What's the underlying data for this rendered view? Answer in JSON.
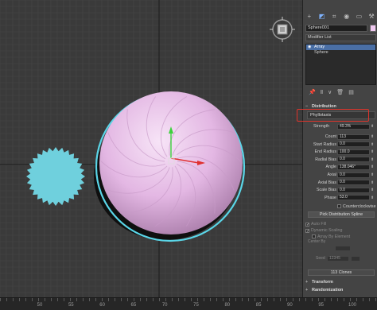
{
  "panel": {
    "tabs": [
      {
        "name": "create-tab-icon",
        "glyph": "+"
      },
      {
        "name": "modify-tab-icon",
        "glyph": "◩"
      },
      {
        "name": "hierarchy-tab-icon",
        "glyph": "⌗"
      },
      {
        "name": "motion-tab-icon",
        "glyph": "◉"
      },
      {
        "name": "display-tab-icon",
        "glyph": "▭"
      },
      {
        "name": "utilities-tab-icon",
        "glyph": "⚒"
      }
    ],
    "object_name": "Sphere001",
    "object_color": "#f0c8f0",
    "modifier_list_label": "Modifier List",
    "stack": [
      {
        "label": "Array",
        "selected": true
      },
      {
        "label": "Sphere",
        "selected": false
      }
    ],
    "distribution_title": "Distribution",
    "distribution_mode": "Phyllotaxis",
    "params": [
      {
        "label": "Strength",
        "value": "49.3%"
      },
      {
        "label": "Count",
        "value": "113"
      },
      {
        "label": "Start Radius",
        "value": "0.0"
      },
      {
        "label": "End Radius",
        "value": "100.0"
      },
      {
        "label": "Radial Bias",
        "value": "0.0"
      },
      {
        "label": "Angle",
        "value": "138.046°"
      },
      {
        "label": "Axial",
        "value": "0.0"
      },
      {
        "label": "Axial Bias",
        "value": "0.0"
      },
      {
        "label": "Scale Bias",
        "value": "0.0"
      },
      {
        "label": "Phase",
        "value": "53.0"
      }
    ],
    "counterclockwise_label": "Counterclockwise",
    "pick_spline_label": "Pick Distribution Spline",
    "auto_fill_label": "Auto Fill",
    "dynamic_scaling_label": "Dynamic Scaling",
    "array_by_element_label": "Array By Element",
    "center_by_label": "Center By",
    "seed_label": "Seed",
    "seed_value": "12345",
    "clones_label": "113 Clones",
    "transform_title": "Transform",
    "randomization_title": "Randomization"
  },
  "ruler": {
    "labels": [
      "50",
      "55",
      "60",
      "65",
      "70",
      "75",
      "80",
      "85",
      "90",
      "95",
      "100"
    ]
  },
  "colors": {
    "viewport_bg": "#3a3a3a",
    "grid": "#4a4a4a",
    "sphere": "#e6b8e6",
    "selection": "#5ad6e8",
    "gear": "#6fd0dd"
  }
}
